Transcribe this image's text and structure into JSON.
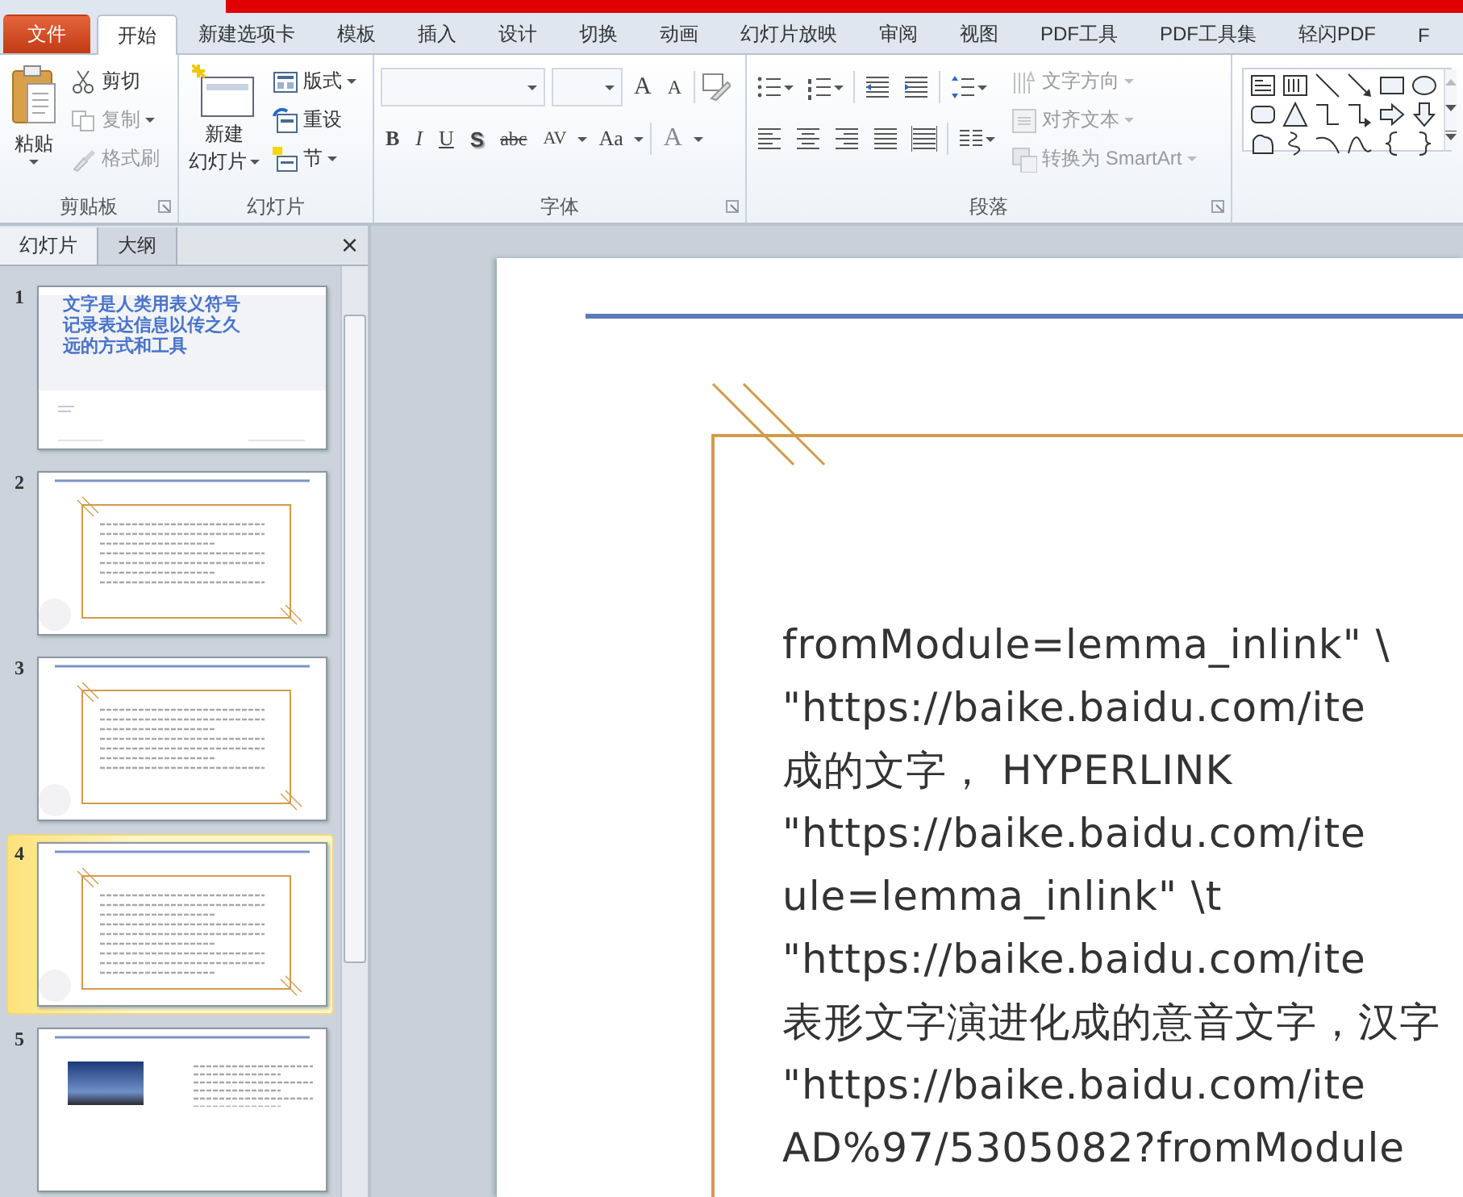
{
  "tabs": [
    {
      "label": "文件",
      "kind": "file",
      "selected": false
    },
    {
      "label": "开始",
      "kind": "tab",
      "selected": true
    },
    {
      "label": "新建选项卡",
      "kind": "tab",
      "selected": false
    },
    {
      "label": "模板",
      "kind": "tab",
      "selected": false
    },
    {
      "label": "插入",
      "kind": "tab",
      "selected": false
    },
    {
      "label": "设计",
      "kind": "tab",
      "selected": false
    },
    {
      "label": "切换",
      "kind": "tab",
      "selected": false
    },
    {
      "label": "动画",
      "kind": "tab",
      "selected": false
    },
    {
      "label": "幻灯片放映",
      "kind": "tab",
      "selected": false
    },
    {
      "label": "审阅",
      "kind": "tab",
      "selected": false
    },
    {
      "label": "视图",
      "kind": "tab",
      "selected": false
    },
    {
      "label": "PDF工具",
      "kind": "tab",
      "selected": false
    },
    {
      "label": "PDF工具集",
      "kind": "tab",
      "selected": false
    },
    {
      "label": "轻闪PDF",
      "kind": "tab",
      "selected": false
    },
    {
      "label": "F",
      "kind": "tab",
      "selected": false
    }
  ],
  "ribbon": {
    "clipboard": {
      "label": "剪贴板",
      "paste": "粘贴",
      "commands": [
        {
          "label": "剪切",
          "disabled": false
        },
        {
          "label": "复制",
          "disabled": true
        },
        {
          "label": "格式刷",
          "disabled": true
        }
      ]
    },
    "slides": {
      "label": "幻灯片",
      "new_slide": [
        "新建",
        "幻灯片"
      ],
      "commands": [
        {
          "label": "版式",
          "dropdown": true
        },
        {
          "label": "重设",
          "dropdown": false
        },
        {
          "label": "节",
          "dropdown": true
        }
      ]
    },
    "font": {
      "label": "字体",
      "sizers": [
        "A",
        "A"
      ],
      "styles": [
        {
          "text": "B",
          "kind": "bold"
        },
        {
          "text": "I",
          "kind": "italic"
        },
        {
          "text": "U",
          "kind": "underline"
        },
        {
          "text": "S",
          "kind": "shadow"
        },
        {
          "text": "abc",
          "kind": "strike"
        },
        {
          "text": "AV",
          "kind": "spacing"
        },
        {
          "text": "Aa",
          "kind": "case"
        },
        {
          "text": "A",
          "kind": "color"
        }
      ]
    },
    "paragraph": {
      "label": "段落",
      "commands": [
        {
          "label": "文字方向",
          "disabled": true
        },
        {
          "label": "对齐文本",
          "disabled": true
        },
        {
          "label": "转换为 SmartArt",
          "disabled": true
        }
      ]
    }
  },
  "panel": {
    "tabs": [
      {
        "label": "幻灯片",
        "selected": true
      },
      {
        "label": "大纲",
        "selected": false
      }
    ],
    "close": "×",
    "slides": [
      {
        "number": "1",
        "kind": "title",
        "selected": false,
        "title": [
          "文字是人类用表义符号",
          "记录表达信息以传之久",
          "远的方式和工具"
        ]
      },
      {
        "number": "2",
        "kind": "text",
        "selected": false
      },
      {
        "number": "3",
        "kind": "text",
        "selected": false
      },
      {
        "number": "4",
        "kind": "text",
        "selected": true
      },
      {
        "number": "5",
        "kind": "photo",
        "selected": false
      }
    ]
  },
  "slide": {
    "lines": [
      "fromModule=lemma_inlink\" \\",
      "\"https://baike.baidu.com/ite",
      "成的文字， HYPERLINK",
      "\"https://baike.baidu.com/ite",
      "ule=lemma_inlink\" \\t",
      "\"https://baike.baidu.com/ite",
      "表形文字演进化成的意音文字，汉字",
      "\"https://baike.baidu.com/ite",
      "AD%97/5305082?fromModule"
    ]
  }
}
